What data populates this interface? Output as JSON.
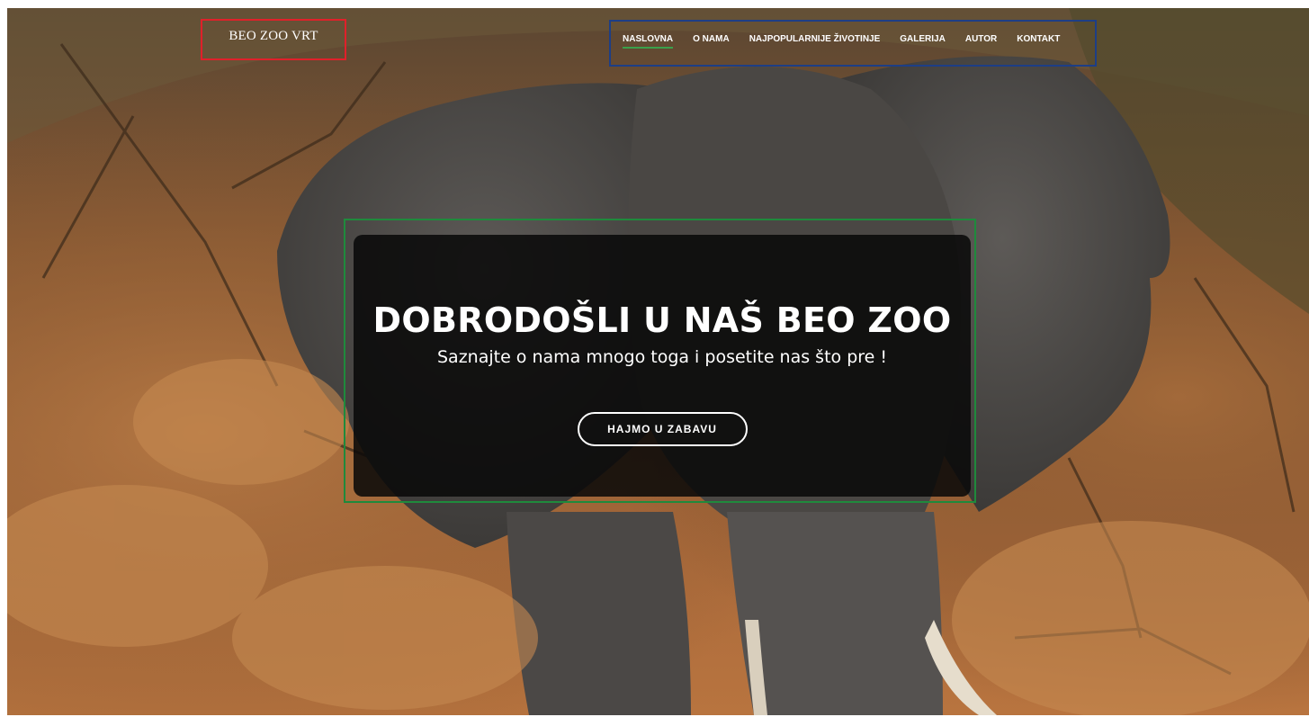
{
  "header": {
    "logo": "BEO ZOO VRT",
    "nav": [
      {
        "label": "NASLOVNA",
        "active": true
      },
      {
        "label": "O NAMA",
        "active": false
      },
      {
        "label": "NAJPOPULARNIJE ŽIVOTINJE",
        "active": false
      },
      {
        "label": "GALERIJA",
        "active": false
      },
      {
        "label": "AUTOR",
        "active": false
      },
      {
        "label": "KONTAKT",
        "active": false
      }
    ]
  },
  "hero": {
    "title": "DOBRODOŠLI U NAŠ BEO ZOO",
    "subtitle": "Saznajte o nama mnogo toga i posetite nas što pre !",
    "button_label": "HAJMO U ZABAVU"
  },
  "colors": {
    "logo_outline": "#e0202a",
    "nav_outline": "#1d3e86",
    "hero_outline": "#1f8a3c",
    "active_underline": "#3aa14b",
    "card_background": "#080808"
  },
  "background": {
    "subject": "elephant-in-savanna-photo"
  }
}
